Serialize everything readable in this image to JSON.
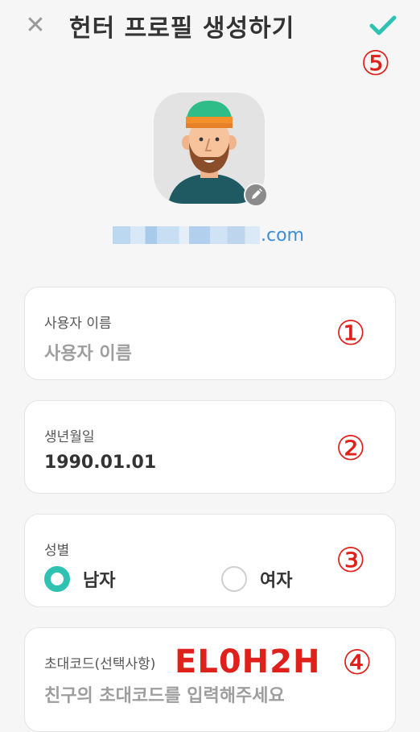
{
  "header": {
    "title": "헌터 프로필 생성하기",
    "close_icon": "close-icon",
    "confirm_icon": "check-icon",
    "confirm_color": "#2fc1b1"
  },
  "annotations": [
    "①",
    "②",
    "③",
    "④",
    "⑤"
  ],
  "profile": {
    "avatar_icon": "avatar-illustration",
    "edit_icon": "pencil-icon",
    "email_suffix": ".com"
  },
  "form": {
    "username": {
      "label": "사용자 이름",
      "placeholder": "사용자 이름"
    },
    "birthdate": {
      "label": "생년월일",
      "value": "1990.01.01"
    },
    "gender": {
      "label": "성별",
      "options": [
        {
          "label": "남자",
          "selected": true
        },
        {
          "label": "여자",
          "selected": false
        }
      ]
    },
    "invite": {
      "label": "초대코드(선택사항)",
      "code": "EL0H2H",
      "placeholder": "친구의 초대코드를 입력해주세요"
    }
  },
  "colors": {
    "accent": "#2fc1b1",
    "annotation": "#e0201b",
    "link": "#3a8fd8"
  }
}
